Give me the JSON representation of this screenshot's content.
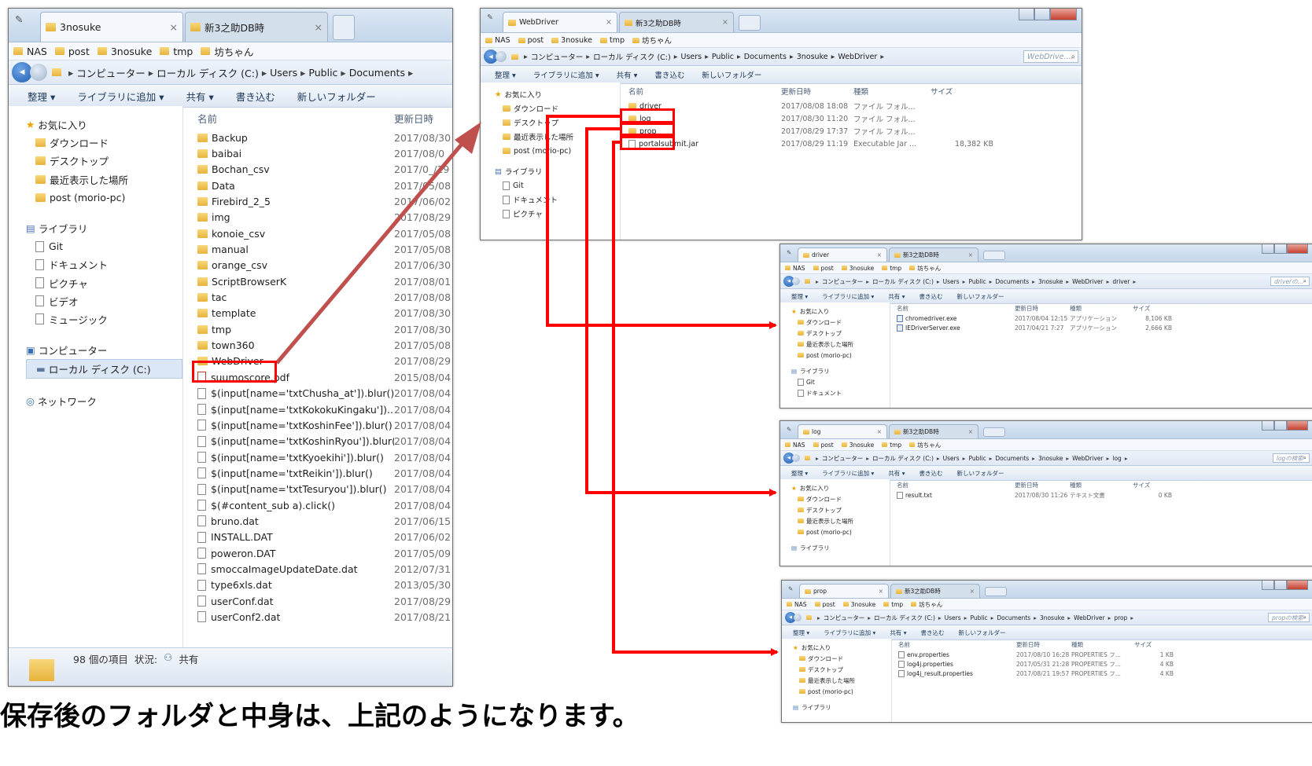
{
  "main_window": {
    "tab_active": "3nosuke",
    "tab_inactive": "新3之助DB時",
    "favorites": [
      "NAS",
      "post",
      "3nosuke",
      "tmp",
      "坊ちゃん"
    ],
    "address": [
      "コンピューター",
      "ローカル ディスク (C:)",
      "Users",
      "Public",
      "Documents"
    ],
    "commands": [
      "整理 ▾",
      "ライブラリに追加 ▾",
      "共有 ▾",
      "書き込む",
      "新しいフォルダー"
    ],
    "nav_fav_header": "お気に入り",
    "nav_fav": [
      "ダウンロード",
      "デスクトップ",
      "最近表示した場所",
      "post (morio-pc)"
    ],
    "nav_lib_header": "ライブラリ",
    "nav_lib": [
      "Git",
      "ドキュメント",
      "ピクチャ",
      "ビデオ",
      "ミュージック"
    ],
    "nav_computer": "コンピューター",
    "nav_disk": "ローカル ディスク (C:)",
    "nav_network": "ネットワーク",
    "col_name": "名前",
    "col_date": "更新日時",
    "files": [
      {
        "name": "Backup",
        "date": "2017/08/30",
        "type": "folder"
      },
      {
        "name": "baibai",
        "date": "2017/08/0",
        "type": "folder"
      },
      {
        "name": "Bochan_csv",
        "date": "2017/0_/19",
        "type": "folder"
      },
      {
        "name": "Data",
        "date": "2017/05/08",
        "type": "folder"
      },
      {
        "name": "Firebird_2_5",
        "date": "2017/06/02",
        "type": "folder"
      },
      {
        "name": "img",
        "date": "2017/08/29",
        "type": "folder"
      },
      {
        "name": "konoie_csv",
        "date": "2017/05/08",
        "type": "folder"
      },
      {
        "name": "manual",
        "date": "2017/05/08",
        "type": "folder"
      },
      {
        "name": "orange_csv",
        "date": "2017/06/30",
        "type": "folder"
      },
      {
        "name": "ScriptBrowserK",
        "date": "2017/08/01",
        "type": "folder"
      },
      {
        "name": "tac",
        "date": "2017/08/08",
        "type": "folder"
      },
      {
        "name": "template",
        "date": "2017/08/30",
        "type": "folder"
      },
      {
        "name": "tmp",
        "date": "2017/08/30",
        "type": "folder"
      },
      {
        "name": "town360",
        "date": "2017/05/08",
        "type": "folder"
      },
      {
        "name": "WebDriver",
        "date": "2017/08/29",
        "type": "folder"
      },
      {
        "name": "suumoscore.pdf",
        "date": "2015/08/04",
        "type": "pdf"
      },
      {
        "name": "$(input[name='txtChusha_at']).blur()",
        "date": "2017/08/04",
        "type": "file"
      },
      {
        "name": "$(input[name='txtKokokuKingaku'])...",
        "date": "2017/08/04",
        "type": "file"
      },
      {
        "name": "$(input[name='txtKoshinFee']).blur()",
        "date": "2017/08/04",
        "type": "file"
      },
      {
        "name": "$(input[name='txtKoshinRyou']).blur()",
        "date": "2017/08/04",
        "type": "file"
      },
      {
        "name": "$(input[name='txtKyoekihi']).blur()",
        "date": "2017/08/04",
        "type": "file"
      },
      {
        "name": "$(input[name='txtReikin']).blur()",
        "date": "2017/08/04",
        "type": "file"
      },
      {
        "name": "$(input[name='txtTesuryou']).blur()",
        "date": "2017/08/04",
        "type": "file"
      },
      {
        "name": "$(#content_sub a).click()",
        "date": "2017/08/04",
        "type": "file"
      },
      {
        "name": "bruno.dat",
        "date": "2017/06/15",
        "type": "file"
      },
      {
        "name": "INSTALL.DAT",
        "date": "2017/06/02",
        "type": "file"
      },
      {
        "name": "poweron.DAT",
        "date": "2017/05/09",
        "type": "file"
      },
      {
        "name": "smoccaImageUpdateDate.dat",
        "date": "2012/07/31",
        "type": "file"
      },
      {
        "name": "type6xls.dat",
        "date": "2013/05/30",
        "type": "file"
      },
      {
        "name": "userConf.dat",
        "date": "2017/08/29",
        "type": "file"
      },
      {
        "name": "userConf2.dat",
        "date": "2017/08/21",
        "type": "file"
      }
    ],
    "status_count": "98 個の項目",
    "status_state": "状況:",
    "status_share": "共有"
  },
  "webdriver_window": {
    "tab_active": "WebDriver",
    "tab_inactive": "新3之助DB時",
    "favorites": [
      "NAS",
      "post",
      "3nosuke",
      "tmp",
      "坊ちゃん"
    ],
    "address": [
      "コンピューター",
      "ローカル ディスク (C:)",
      "Users",
      "Public",
      "Documents",
      "3nosuke",
      "WebDriver"
    ],
    "search_placeholder": "WebDrive...",
    "commands": [
      "整理 ▾",
      "ライブラリに追加 ▾",
      "共有 ▾",
      "書き込む",
      "新しいフォルダー"
    ],
    "nav_fav_header": "お気に入り",
    "nav_fav": [
      "ダウンロード",
      "デスクトップ",
      "最近表示した場所",
      "post (morio-pc)"
    ],
    "nav_lib_header": "ライブラリ",
    "nav_lib": [
      "Git",
      "ドキュメント",
      "ピクチャ"
    ],
    "cols": [
      "名前",
      "更新日時",
      "種類",
      "サイズ"
    ],
    "files": [
      {
        "name": "driver",
        "date": "2017/08/08 18:08",
        "kind": "ファイル フォル...",
        "size": "",
        "type": "folder"
      },
      {
        "name": "log",
        "date": "2017/08/30 11:20",
        "kind": "ファイル フォル...",
        "size": "",
        "type": "folder"
      },
      {
        "name": "prop",
        "date": "2017/08/29 17:37",
        "kind": "ファイル フォル...",
        "size": "",
        "type": "folder"
      },
      {
        "name": "portalsubmit.jar",
        "date": "2017/08/29 11:19",
        "kind": "Executable Jar ...",
        "size": "18,382 KB",
        "type": "file"
      }
    ]
  },
  "driver_window": {
    "tab_active": "driver",
    "tab_inactive": "新3之助DB時",
    "favorites": [
      "NAS",
      "post",
      "3nosuke",
      "tmp",
      "坊ちゃん"
    ],
    "address": [
      "コンピューター",
      "ローカル ディスク (C:)",
      "Users",
      "Public",
      "Documents",
      "3nosuke",
      "WebDriver",
      "driver"
    ],
    "search_placeholder": "driverの...",
    "commands": [
      "整理 ▾",
      "ライブラリに追加 ▾",
      "共有 ▾",
      "書き込む",
      "新しいフォルダー"
    ],
    "nav_fav_header": "お気に入り",
    "nav_fav": [
      "ダウンロード",
      "デスクトップ",
      "最近表示した場所",
      "post (morio-pc)"
    ],
    "nav_lib_header": "ライブラリ",
    "nav_lib": [
      "Git",
      "ドキュメント"
    ],
    "cols": [
      "名前",
      "更新日時",
      "種類",
      "サイズ"
    ],
    "files": [
      {
        "name": "chromedriver.exe",
        "date": "2017/08/04 12:15",
        "kind": "アプリケーション",
        "size": "8,106 KB",
        "type": "exe"
      },
      {
        "name": "IEDriverServer.exe",
        "date": "2017/04/21 7:27",
        "kind": "アプリケーション",
        "size": "2,666 KB",
        "type": "exe"
      }
    ]
  },
  "log_window": {
    "tab_active": "log",
    "tab_inactive": "新3之助DB時",
    "favorites": [
      "NAS",
      "post",
      "3nosuke",
      "tmp",
      "坊ちゃん"
    ],
    "address": [
      "コンピューター",
      "ローカル ディスク (C:)",
      "Users",
      "Public",
      "Documents",
      "3nosuke",
      "WebDriver",
      "log"
    ],
    "search_placeholder": "logの検索",
    "commands": [
      "整理 ▾",
      "ライブラリに追加 ▾",
      "共有 ▾",
      "書き込む",
      "新しいフォルダー"
    ],
    "nav_fav_header": "お気に入り",
    "nav_fav": [
      "ダウンロード",
      "デスクトップ",
      "最近表示した場所",
      "post (morio-pc)"
    ],
    "nav_lib_header": "ライブラリ",
    "nav_lib": [],
    "cols": [
      "名前",
      "更新日時",
      "種類",
      "サイズ"
    ],
    "files": [
      {
        "name": "result.txt",
        "date": "2017/08/30 11:26",
        "kind": "テキスト文書",
        "size": "0 KB",
        "type": "file"
      }
    ]
  },
  "prop_window": {
    "tab_active": "prop",
    "tab_inactive": "新3之助DB時",
    "favorites": [
      "NAS",
      "post",
      "3nosuke",
      "tmp",
      "坊ちゃん"
    ],
    "address": [
      "コンピューター",
      "ローカル ディスク (C:)",
      "Users",
      "Public",
      "Documents",
      "3nosuke",
      "WebDriver",
      "prop"
    ],
    "search_placeholder": "propの検索",
    "commands": [
      "整理 ▾",
      "ライブラリに追加 ▾",
      "共有 ▾",
      "書き込む",
      "新しいフォルダー"
    ],
    "nav_fav_header": "お気に入り",
    "nav_fav": [
      "ダウンロード",
      "デスクトップ",
      "最近表示した場所",
      "post (morio-pc)"
    ],
    "nav_lib_header": "ライブラリ",
    "nav_lib": [],
    "cols": [
      "名前",
      "更新日時",
      "種類",
      "サイズ"
    ],
    "files": [
      {
        "name": "env.properties",
        "date": "2017/08/10 16:28",
        "kind": "PROPERTIES フ...",
        "size": "1 KB",
        "type": "file"
      },
      {
        "name": "log4j.properties",
        "date": "2017/05/31 21:28",
        "kind": "PROPERTIES フ...",
        "size": "4 KB",
        "type": "file"
      },
      {
        "name": "log4j_result.properties",
        "date": "2017/08/21 19:57",
        "kind": "PROPERTIES フ...",
        "size": "4 KB",
        "type": "file"
      }
    ]
  },
  "caption": "保存後のフォルダと中身は、上記のようになります。",
  "colors": {
    "highlight": "#ff0000",
    "arrow": "#c0504d"
  }
}
